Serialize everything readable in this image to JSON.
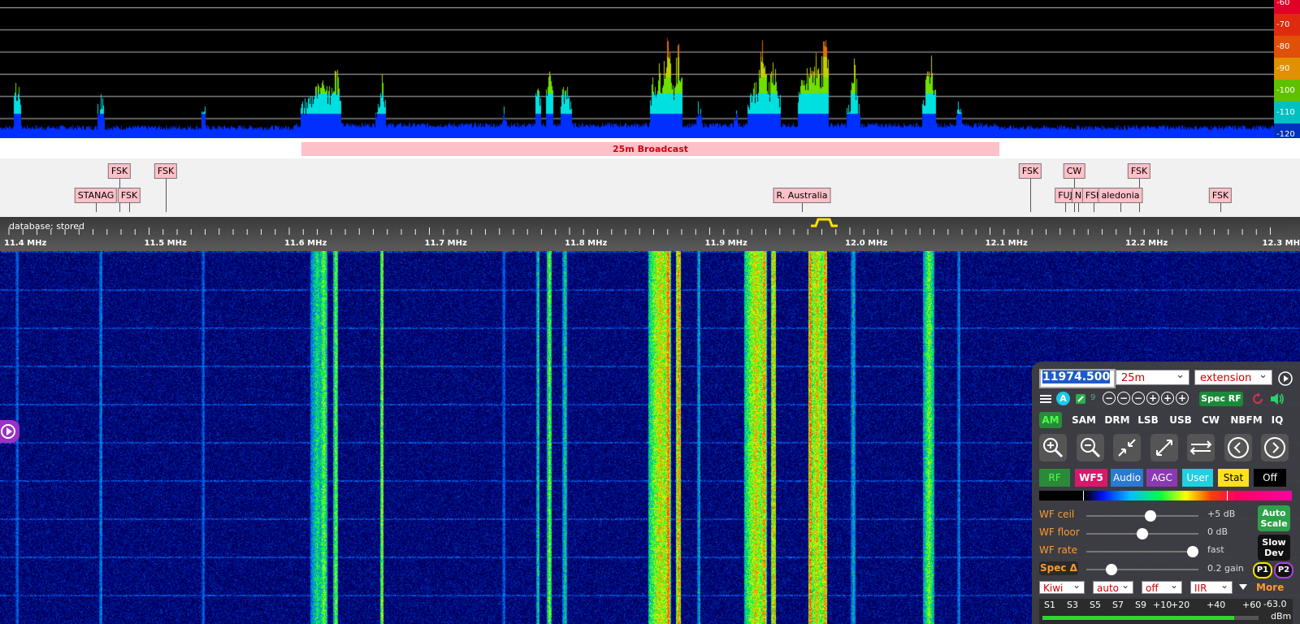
{
  "spectrum": {
    "db_labels": [
      "-60",
      "-70",
      "-80",
      "-90",
      "-100",
      "-110",
      "-120"
    ],
    "db_colors": [
      "#e00028",
      "#e02a10",
      "#e05008",
      "#e09000",
      "#60c000",
      "#00c0c0",
      "#0030c0"
    ]
  },
  "band": {
    "name": "25m Broadcast"
  },
  "station_labels": [
    "FSK",
    "FSK",
    "STANAG",
    "FSK",
    "FSK",
    "CW",
    "FSK",
    "R. Australia",
    "FUJ",
    "N",
    "FSK",
    "aledonia",
    "FSK"
  ],
  "scale": {
    "db_status": "database: stored",
    "freq_labels": [
      "11.4 MHz",
      "11.5 MHz",
      "11.6 MHz",
      "11.7 MHz",
      "11.8 MHz",
      "11.9 MHz",
      "12.0 MHz",
      "12.1 MHz",
      "12.2 MHz",
      "12.3 MHz"
    ]
  },
  "controls": {
    "frequency": "11974.500",
    "band_select": "25m",
    "extension_select": "extension",
    "a_badge": "A",
    "small_num": "9",
    "spec_rf": "Spec RF",
    "modes": [
      "AM",
      "SAM",
      "DRM",
      "LSB",
      "USB",
      "CW",
      "NBFM",
      "IQ"
    ],
    "colored_buttons": [
      "RF",
      "WF5",
      "Audio",
      "AGC",
      "User",
      "Stat",
      "Off"
    ],
    "sliders": {
      "wf_ceil_label": "WF ceil",
      "wf_ceil_value": "+5 dB",
      "wf_floor_label": "WF floor",
      "wf_floor_value": "0 dB",
      "wf_rate_label": "WF rate",
      "wf_rate_value": "fast",
      "spec_label": "Spec Δ",
      "spec_value": "0.2 gain"
    },
    "auto_scale": "Auto Scale",
    "slow_dev": "Slow Dev",
    "p1": "P1",
    "p2": "P2",
    "bottom_selects": [
      "Kiwi",
      "auto",
      "off",
      "IIR"
    ],
    "more": "More",
    "smeter": {
      "ticks": [
        "S1",
        "S3",
        "S5",
        "S7",
        "S9",
        "+10",
        "+20",
        "+40",
        "+60"
      ],
      "value": "-63.0",
      "unit": "dBm"
    }
  }
}
